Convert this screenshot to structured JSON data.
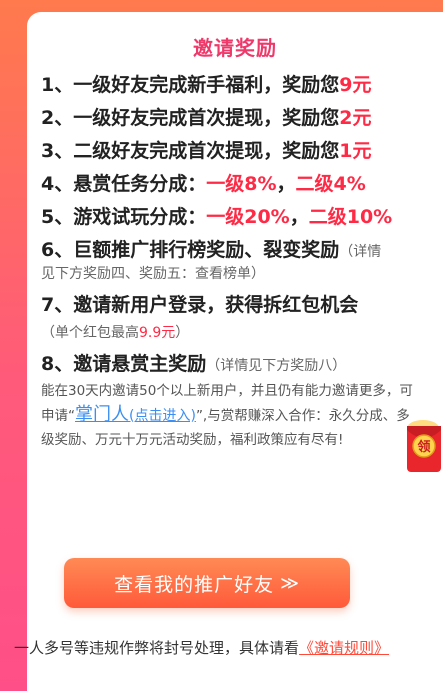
{
  "header": {
    "title": "邀请奖励"
  },
  "rewards": [
    {
      "prefix": "1、一级好友完成新手福利，奖励您",
      "value": "9元"
    },
    {
      "prefix": "2、一级好友完成首次提现，奖励您",
      "value": "2元"
    },
    {
      "prefix": "3、二级好友完成首次提现，奖励您",
      "value": "1元"
    },
    {
      "prefix": "4、悬赏任务分成：",
      "level1": "一级8%",
      "sep": "，",
      "level2": "二级4%"
    },
    {
      "prefix": "5、游戏试玩分成：",
      "level1": "一级20%",
      "sep": "，",
      "level2": "二级10%"
    },
    {
      "main": "6、巨额推广排行榜奖励、裂变奖励",
      "note_start": "（详情",
      "note_rest": "见下方奖励四、奖励五：查看榜单）"
    },
    {
      "main": "7、邀请新用户登录，获得拆红包机会",
      "note_prefix": "（单个红包最高",
      "note_value": "9.9元",
      "note_suffix": "）"
    },
    {
      "main": "8、邀请悬赏主奖励",
      "note": "（详情见下方奖励八）"
    }
  ],
  "description": {
    "part1": "能在30天内邀请50个以上新用户，并且仍有能力邀请更多，可申请“",
    "link_main": "掌门人",
    "link_sub": "(点击进入)",
    "part2": "”,与赏帮赚深入合作：永久分成、多级奖励、万元十万元活动奖励，福利政策应有尽有!"
  },
  "button": {
    "label": "查看我的推广好友",
    "arrow": "≫"
  },
  "footer": {
    "text": "一人多号等违规作弊将封号处理，具体请看",
    "link": "《邀请规则》"
  },
  "redpacket": {
    "label": "领",
    "icon": "red-packet-icon"
  }
}
